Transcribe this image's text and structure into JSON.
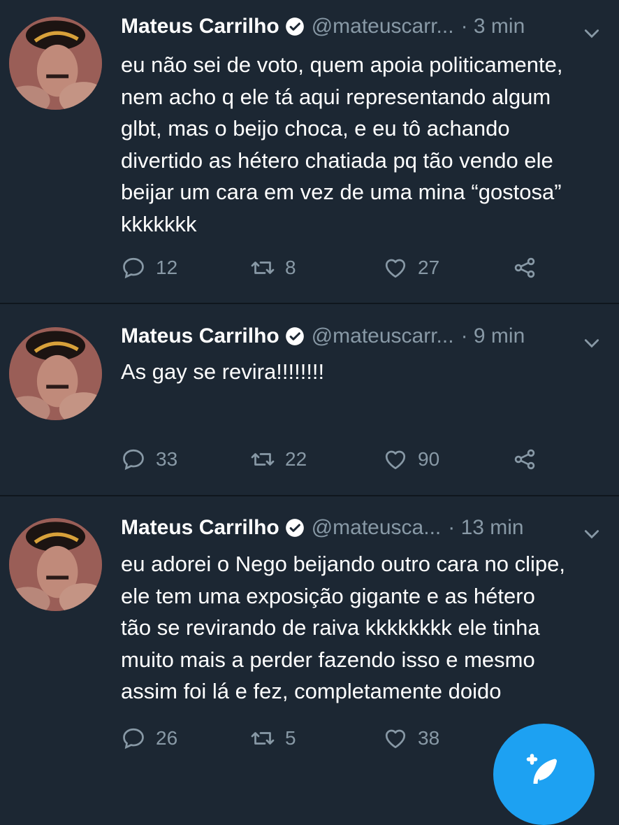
{
  "colors": {
    "background": "#1c2733",
    "secondary_text": "#8899a6",
    "accent": "#1da1f2",
    "divider": "#0f161d"
  },
  "tweets": [
    {
      "name": "Mateus Carrilho",
      "handle": "@mateuscarr...",
      "time": "· 3 min",
      "text": "eu não sei de voto, quem apoia politicamente,\nnem acho q ele tá aqui representando algum\nglbt, mas o beijo choca, e eu tô achando\ndivertido as hétero chatiada pq tão vendo ele\nbeijar um cara em vez de uma mina “gostosa”\nkkkkkkk",
      "replies": "12",
      "retweets": "8",
      "likes": "27"
    },
    {
      "name": "Mateus Carrilho",
      "handle": "@mateuscarr...",
      "time": "· 9 min",
      "text": "As gay se revira!!!!!!!!",
      "replies": "33",
      "retweets": "22",
      "likes": "90"
    },
    {
      "name": "Mateus Carrilho",
      "handle": "@mateusca...",
      "time": "· 13 min",
      "text": "eu adorei o Nego beijando outro cara no clipe,\nele tem uma exposição gigante e as hétero\ntão se revirando de raiva kkkkkkkk ele tinha\nmuito mais a perder fazendo isso e mesmo\nassim foi lá e fez, completamente doido",
      "replies": "26",
      "retweets": "5",
      "likes": "38"
    }
  ],
  "icons": {
    "verified": "verified-badge-icon",
    "more": "chevron-down-icon",
    "reply": "reply-icon",
    "retweet": "retweet-icon",
    "like": "heart-icon",
    "share": "share-icon",
    "compose": "compose-tweet-icon"
  }
}
